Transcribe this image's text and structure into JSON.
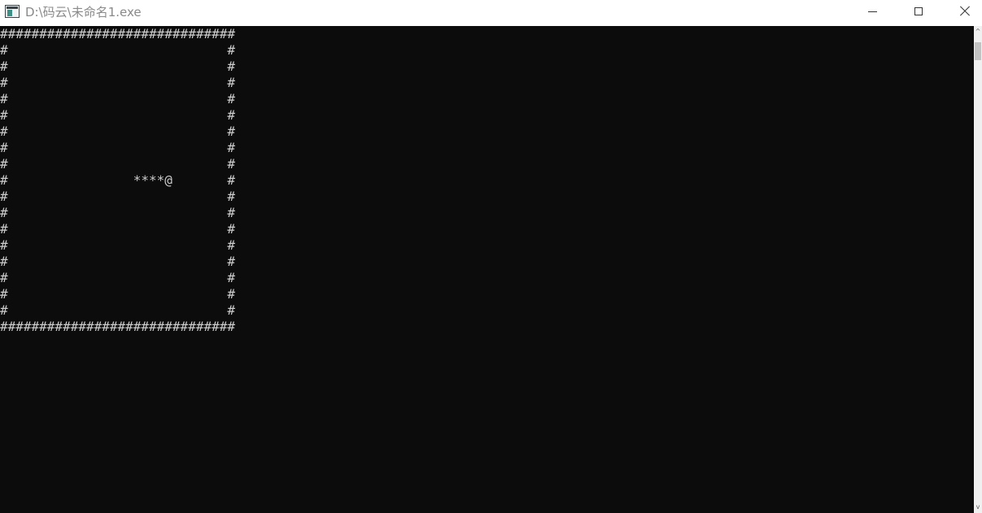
{
  "window": {
    "title": "D:\\码云\\未命名1.exe"
  },
  "console": {
    "text": "##############################\n#                            #\n#                            #\n#                            #\n#                            #\n#                            #\n#                            #\n#                            #\n#                            #\n#                ****@       #\n#                            #\n#                            #\n#                            #\n#                            #\n#                            #\n#                            #\n#                            #\n#                            #\n##############################"
  },
  "scrollbar": {
    "up_glyph": "^",
    "down_glyph": "v"
  }
}
